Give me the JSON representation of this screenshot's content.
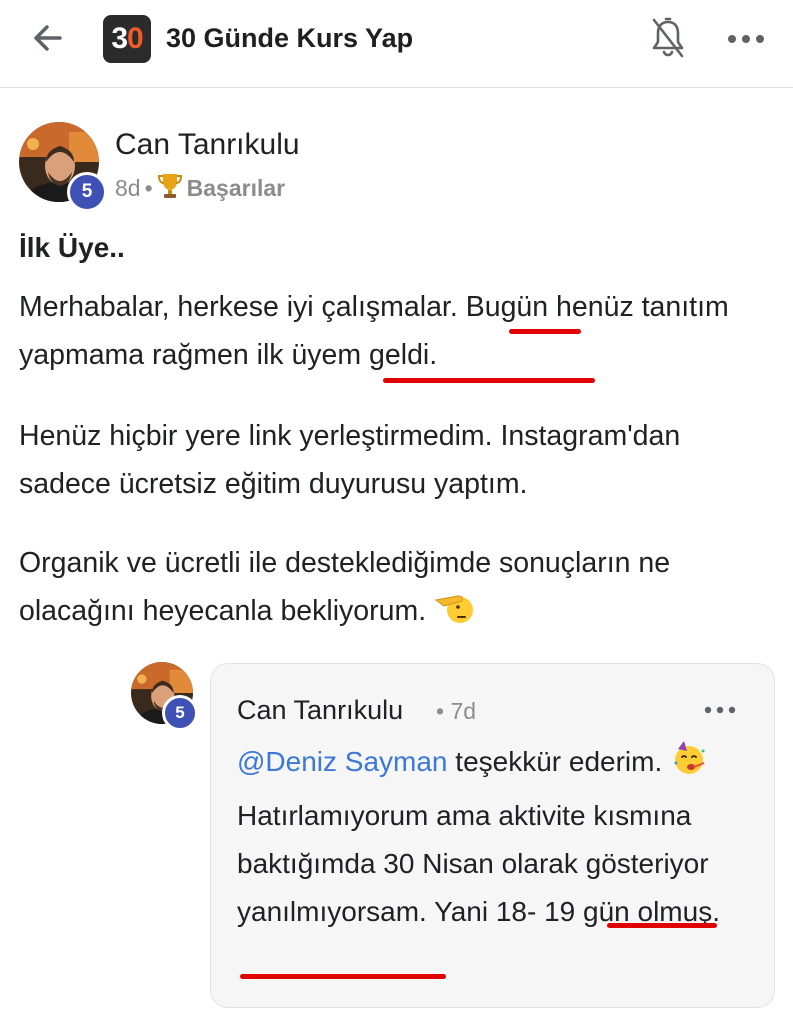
{
  "header": {
    "back_icon": "arrow-left-icon",
    "logo_text_a": "3",
    "logo_text_b": "0",
    "title": "30 Günde Kurs Yap",
    "bell_icon": "bell-off-icon",
    "more_icon": "more-horizontal-icon"
  },
  "post": {
    "author": "Can Tanrıkulu",
    "level": "5",
    "time": "8d",
    "separator": "•",
    "category": "Başarılar",
    "category_icon": "trophy-icon",
    "title": "İlk Üye..",
    "paragraph1_part1": "Merhabalar, herkese iyi çalışmalar. ",
    "paragraph1_highlight1": "Bugün",
    "paragraph1_part2": " henüz tanıtım yapmama rağmen ",
    "paragraph1_highlight2": "ilk üyem geldi.",
    "paragraph2": "Henüz hiçbir yere link yerleştirmedim. Instagram'dan sadece ücretsiz eğitim duyurusu yaptım.",
    "paragraph3": "Organik ve ücretli ile desteklediğimde sonuçların ne olacağını heyecanla bekliyorum.",
    "paragraph3_emoji": "saluting-face-emoji",
    "highlight_color": "#e10000"
  },
  "comment": {
    "author": "Can Tanrıkulu",
    "level": "5",
    "separator": "•",
    "time": "7d",
    "more_icon": "more-horizontal-icon",
    "mention": "@Deniz Sayman",
    "text_part1": " teşekkür ederim. ",
    "emoji": "partying-face-emoji",
    "text_part2": " Hatırlamıyorum ama aktivite kısmına baktığımda 30 Nisan olarak gösteriyor yanılmıyorsam. ",
    "text_highlight_line1": "Yani 18-",
    "text_highlight_line2": "19 gün olmuş.",
    "mention_color": "#3b78d8"
  }
}
